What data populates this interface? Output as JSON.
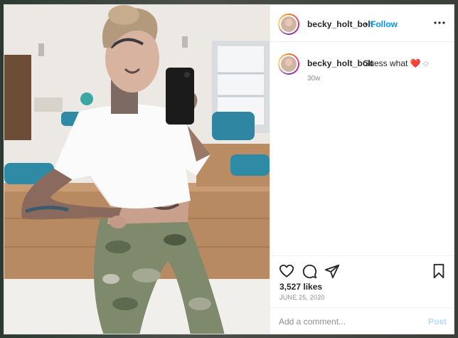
{
  "post": {
    "username": "becky_holt_bolt",
    "dot": "•",
    "follow_label": "Follow",
    "more_icon": "more-horizontal-icon",
    "caption_text": "Guess what ❤️ ◌",
    "caption_time": "30w",
    "likes": "3,527 likes",
    "date": "JUNE 25, 2020",
    "comment_placeholder": "Add a comment...",
    "post_label": "Post"
  },
  "icons": {
    "like": "heart-icon",
    "comment": "comment-icon",
    "share": "send-icon",
    "save": "bookmark-icon"
  },
  "colors": {
    "link_blue": "#0095f6",
    "post_disabled": "#b3dbff",
    "text": "#262626",
    "muted": "#8e8e8e"
  }
}
